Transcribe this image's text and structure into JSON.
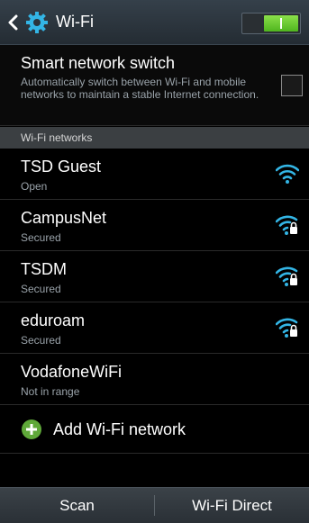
{
  "header": {
    "title": "Wi-Fi",
    "wifi_enabled": true
  },
  "smart_switch": {
    "title": "Smart network switch",
    "description": "Automatically switch between Wi-Fi and mobile networks to maintain a stable Internet connection.",
    "checked": false
  },
  "section": {
    "label": "Wi-Fi networks"
  },
  "networks": [
    {
      "name": "TSD Guest",
      "status": "Open",
      "icon": "wifi-open-icon"
    },
    {
      "name": "CampusNet",
      "status": "Secured",
      "icon": "wifi-secured-icon"
    },
    {
      "name": "TSDM",
      "status": "Secured",
      "icon": "wifi-secured-icon"
    },
    {
      "name": "eduroam",
      "status": "Secured",
      "icon": "wifi-secured-icon"
    },
    {
      "name": "VodafoneWiFi",
      "status": "Not in range",
      "icon": ""
    }
  ],
  "add_network": {
    "label": "Add Wi-Fi network"
  },
  "bottom": {
    "scan_label": "Scan",
    "direct_label": "Wi-Fi Direct"
  },
  "colors": {
    "accent": "#33b5e5",
    "toggle_on": "#6cc83a",
    "add_green": "#5fa839"
  }
}
